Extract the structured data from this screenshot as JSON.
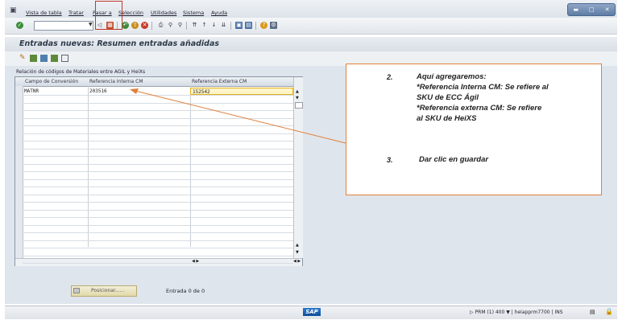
{
  "menu": {
    "items": [
      "Vista de tabla",
      "Tratar",
      "Pasar a",
      "Selección",
      "Utilidades",
      "Sistema",
      "Ayuda"
    ]
  },
  "toolbar": {
    "command_value": "",
    "icons": [
      "check-icon",
      "back-icon",
      "save-icon",
      "exit-icon",
      "cancel-icon",
      "print-icon",
      "find-icon",
      "settings-icon",
      "help-icon"
    ]
  },
  "screen": {
    "title": "Entradas nuevas: Resumen entradas añadidas"
  },
  "table": {
    "title": "Relación de códigos de Materiales entre AGIL y HeiXs",
    "columns": [
      "Campo de Conversión",
      "Referencia Interna CM",
      "Referencia Externa CM"
    ],
    "rows": [
      [
        "MATNR",
        "203516",
        "152542"
      ]
    ]
  },
  "callout": {
    "step2_num": "2.",
    "step2_lines": [
      "Aquí agregaremos:",
      "*Referencia Interna CM: Se refiere al",
      "SKU de ECC Ágil",
      "*Referencia externa CM: Se refiere",
      "al SKU de HeiXS"
    ],
    "step3_num": "3.",
    "step3_text": "Dar clic en guardar"
  },
  "bottom": {
    "position_button": "Posicionar......",
    "entry_count": "Entrada 0 de 0"
  },
  "status": {
    "logo": "SAP",
    "system": "PRM (1) 400",
    "server": "heiapprm7700",
    "mode": "INS"
  },
  "colors": {
    "callout_border": "#e0803a",
    "highlight_box": "#c0392b",
    "edit_cell": "#fff5c8"
  }
}
